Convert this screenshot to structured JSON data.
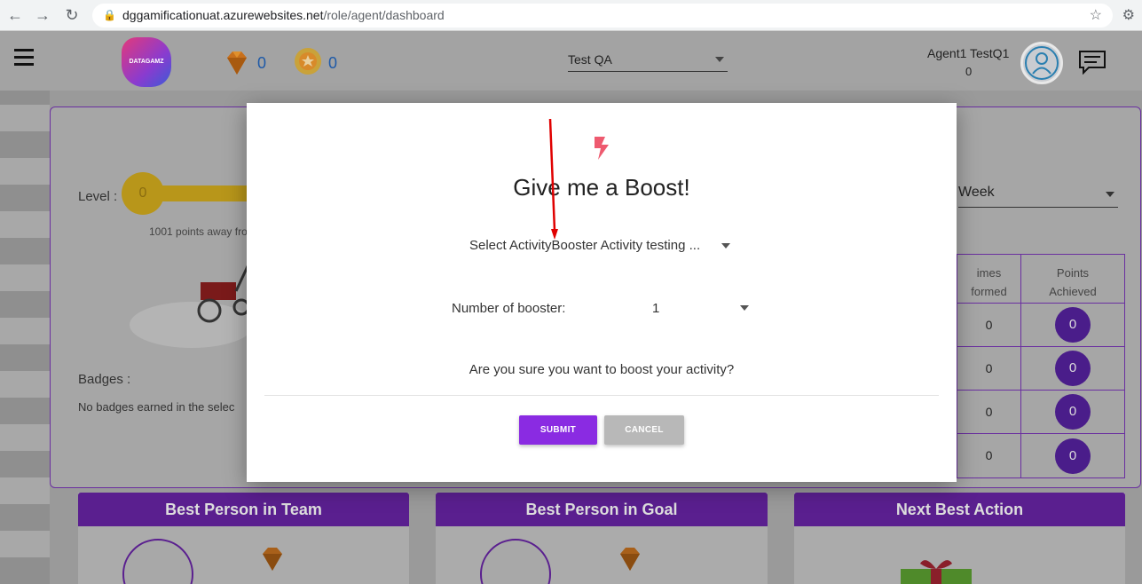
{
  "browser": {
    "url_host": "dggamificationuat.azurewebsites.net",
    "url_path": "/role/agent/dashboard"
  },
  "header": {
    "logo_text": "DATAGAMZ",
    "gems_count": "0",
    "medals_count": "0",
    "team_selected": "Test QA",
    "user_name": "Agent1 TestQ1",
    "user_points": "0"
  },
  "background": {
    "level_label": "Level :",
    "level_value": "0",
    "points_away": "1001 points away fro",
    "badges_label": "Badges :",
    "badges_empty": "No badges earned in the selec",
    "period_selected": "Week",
    "table": {
      "headers": [
        "imes\nformed",
        "Points\nAchieved"
      ],
      "rows": [
        {
          "performed": "0",
          "points": "0"
        },
        {
          "performed": "0",
          "points": "0"
        },
        {
          "performed": "0",
          "points": "0"
        },
        {
          "performed": "0",
          "points": "0"
        }
      ]
    },
    "cards": [
      {
        "title": "Best Person in Team"
      },
      {
        "title": "Best Person in Goal"
      },
      {
        "title": "Next Best Action"
      }
    ]
  },
  "modal": {
    "title": "Give me a Boost!",
    "activity_select": "Select ActivityBooster Activity testing ...",
    "booster_label": "Number of booster:",
    "booster_value": "1",
    "confirm_text": "Are you sure you want to boost your activity?",
    "submit_label": "SUBMIT",
    "cancel_label": "CANCEL"
  },
  "colors": {
    "accent_purple": "#8a2be2",
    "annotation_red": "#e00000"
  }
}
